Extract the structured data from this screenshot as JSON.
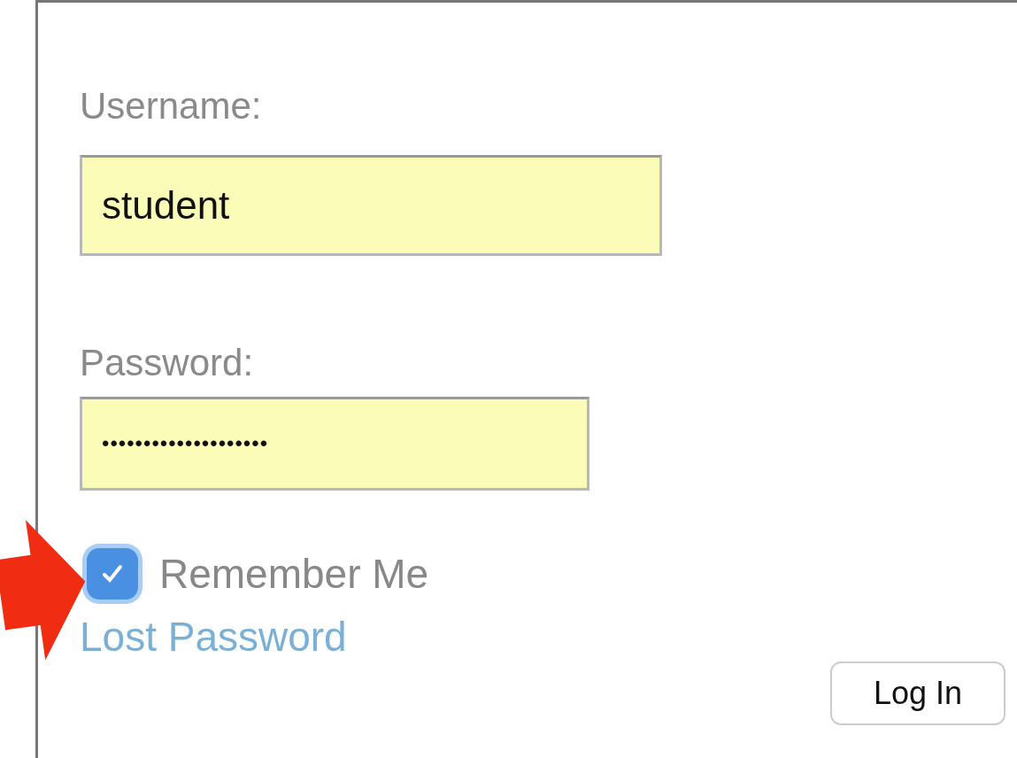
{
  "form": {
    "username": {
      "label": "Username:",
      "value": "student"
    },
    "password": {
      "label": "Password:",
      "value": "••••••••••••••••••••"
    },
    "remember": {
      "label": "Remember Me",
      "checked": true
    },
    "lost_password": "Lost Password",
    "login_button": "Log In"
  }
}
